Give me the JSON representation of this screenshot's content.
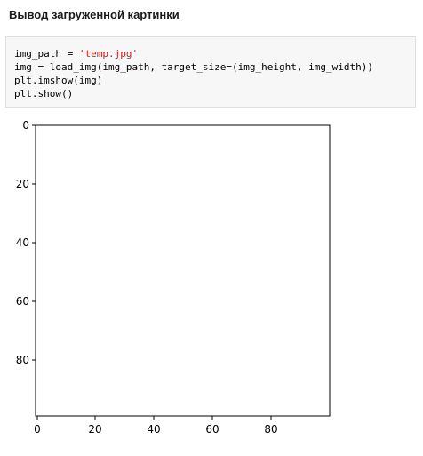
{
  "heading": "Вывод загруженной картинки",
  "code": {
    "line1_var": "img_path = ",
    "line1_str": "'temp.jpg'",
    "line2": "img = load_img(img_path, target_size=(img_height, img_width))",
    "line3": "plt.imshow(img)",
    "line4": "plt.show()"
  },
  "plot": {
    "x_ticks": [
      "0",
      "20",
      "40",
      "60",
      "80"
    ],
    "y_ticks": [
      "0",
      "20",
      "40",
      "60",
      "80"
    ],
    "colors": {
      "wall": "#ddd8cf",
      "window": "#b8c2cf",
      "sofa": "#f0f0ef",
      "orchid_pink": "#c94ec0",
      "orchid_dark": "#8a2f7d",
      "orchid_white": "#f4ecef",
      "stem": "#1f1f1f",
      "leaf": "#6f9b52",
      "pot": "#c9c2b6"
    }
  }
}
